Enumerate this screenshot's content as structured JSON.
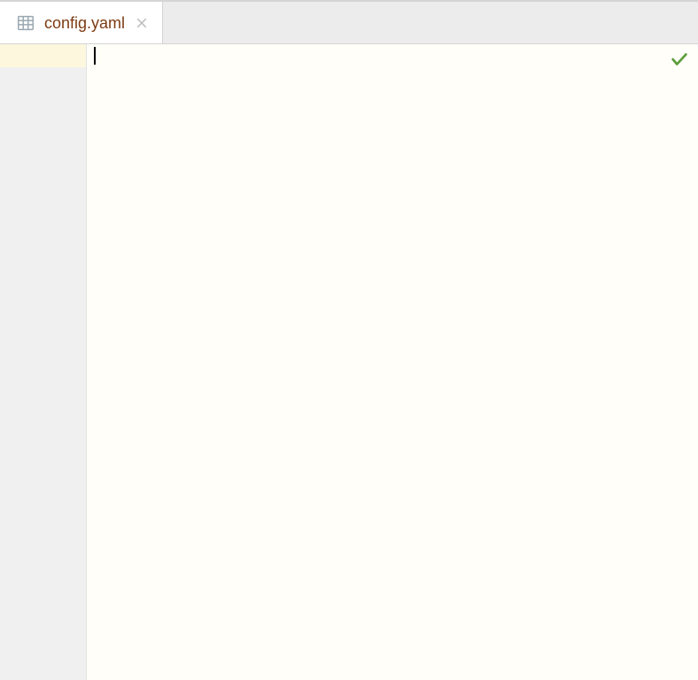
{
  "tabs": [
    {
      "label": "config.yaml",
      "icon": "table-file-icon",
      "active": true
    }
  ],
  "editor": {
    "content": "",
    "current_line": 1
  },
  "status": {
    "inspection_ok": true,
    "icon": "check-icon"
  }
}
